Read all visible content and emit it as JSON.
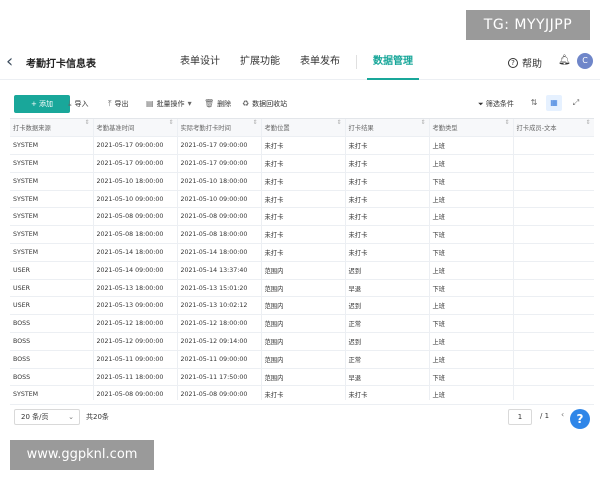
{
  "watermarks": {
    "top_right": "TG: MYYJJPP",
    "bottom_left": "www.ggpknl.com"
  },
  "header": {
    "back_icon": "chevron-left-icon",
    "title": "考勤打卡信息表",
    "nav": [
      {
        "label": "表单设计",
        "active": false
      },
      {
        "label": "扩展功能",
        "active": false
      },
      {
        "label": "表单发布",
        "active": false
      },
      {
        "label": "数据管理",
        "active": true
      }
    ],
    "help_label": "帮助",
    "avatar_letter": "C",
    "accent": "#19a79a"
  },
  "toolbar": {
    "add_label": "+ 添加",
    "import_label": "导入",
    "export_label": "导出",
    "batch_label": "批量操作",
    "delete_label": "删除",
    "recycle_label": "数据回收站",
    "filter_label": "筛选条件"
  },
  "table": {
    "columns": [
      "打卡数据来源",
      "考勤基准时间",
      "实际考勤打卡时间",
      "考勤位置",
      "打卡结果",
      "考勤类型",
      "打卡成员-文本"
    ],
    "rows": [
      [
        "SYSTEM",
        "2021-05-17 09:00:00",
        "2021-05-17 09:00:00",
        "未打卡",
        "未打卡",
        "上班",
        ""
      ],
      [
        "SYSTEM",
        "2021-05-17 09:00:00",
        "2021-05-17 09:00:00",
        "未打卡",
        "未打卡",
        "上班",
        ""
      ],
      [
        "SYSTEM",
        "2021-05-10 18:00:00",
        "2021-05-10 18:00:00",
        "未打卡",
        "未打卡",
        "下班",
        ""
      ],
      [
        "SYSTEM",
        "2021-05-10 09:00:00",
        "2021-05-10 09:00:00",
        "未打卡",
        "未打卡",
        "上班",
        ""
      ],
      [
        "SYSTEM",
        "2021-05-08 09:00:00",
        "2021-05-08 09:00:00",
        "未打卡",
        "未打卡",
        "上班",
        ""
      ],
      [
        "SYSTEM",
        "2021-05-08 18:00:00",
        "2021-05-08 18:00:00",
        "未打卡",
        "未打卡",
        "下班",
        ""
      ],
      [
        "SYSTEM",
        "2021-05-14 18:00:00",
        "2021-05-14 18:00:00",
        "未打卡",
        "未打卡",
        "下班",
        ""
      ],
      [
        "USER",
        "2021-05-14 09:00:00",
        "2021-05-14 13:37:40",
        "范围内",
        "迟到",
        "上班",
        ""
      ],
      [
        "USER",
        "2021-05-13 18:00:00",
        "2021-05-13 15:01:20",
        "范围内",
        "早退",
        "下班",
        ""
      ],
      [
        "USER",
        "2021-05-13 09:00:00",
        "2021-05-13 10:02:12",
        "范围内",
        "迟到",
        "上班",
        ""
      ],
      [
        "BOSS",
        "2021-05-12 18:00:00",
        "2021-05-12 18:00:00",
        "范围内",
        "正常",
        "下班",
        ""
      ],
      [
        "BOSS",
        "2021-05-12 09:00:00",
        "2021-05-12 09:14:00",
        "范围内",
        "迟到",
        "上班",
        ""
      ],
      [
        "BOSS",
        "2021-05-11 09:00:00",
        "2021-05-11 09:00:00",
        "范围内",
        "正常",
        "上班",
        ""
      ],
      [
        "BOSS",
        "2021-05-11 18:00:00",
        "2021-05-11 17:50:00",
        "范围内",
        "早退",
        "下班",
        ""
      ],
      [
        "SYSTEM",
        "2021-05-08 09:00:00",
        "2021-05-08 09:00:00",
        "未打卡",
        "未打卡",
        "上班",
        ""
      ]
    ]
  },
  "footer": {
    "page_size": "20 条/页",
    "total": "共20条",
    "page_current": "1",
    "page_total": "/ 1"
  }
}
